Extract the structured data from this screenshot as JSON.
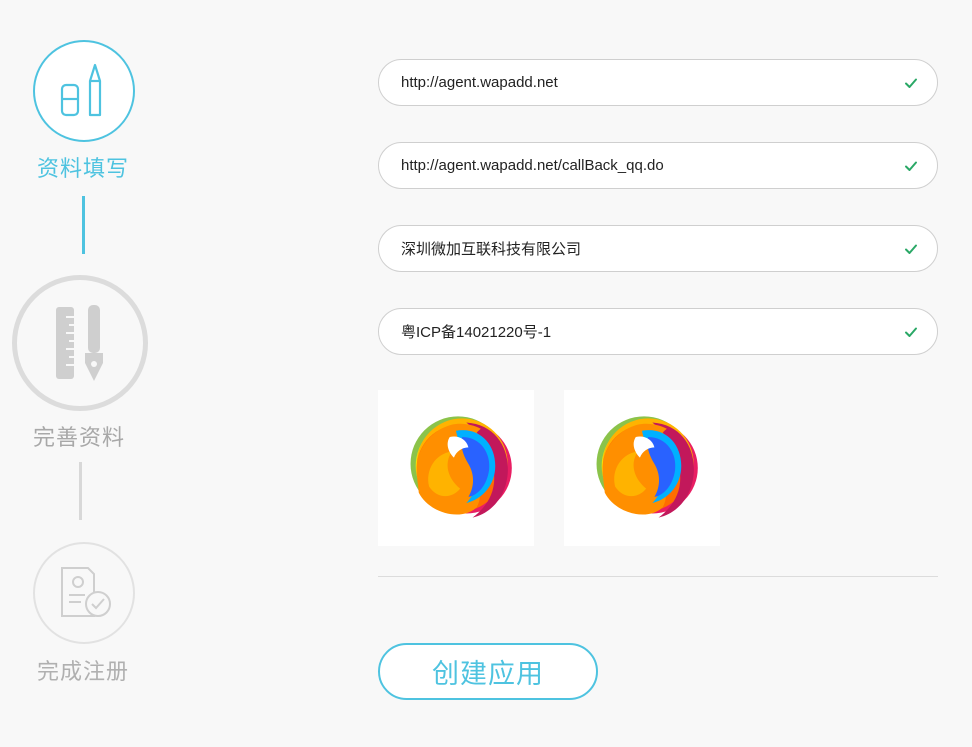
{
  "steps": [
    {
      "label": "资料填写",
      "state": "active",
      "icon": "pencil-eraser-icon"
    },
    {
      "label": "完善资料",
      "state": "pending",
      "icon": "ruler-pen-icon"
    },
    {
      "label": "完成注册",
      "state": "pending",
      "icon": "document-check-icon"
    }
  ],
  "form": {
    "site_url": "http://agent.wapadd.net",
    "callback_url": "http://agent.wapadd.net/callBack_qq.do",
    "company": "深圳微加互联科技有限公司",
    "icp": "粤ICP备14021220号-1"
  },
  "logos": [
    {
      "icon": "app-logo-large"
    },
    {
      "icon": "app-logo-small"
    }
  ],
  "create_button_label": "创建应用",
  "colors": {
    "accent": "#4ec3e0",
    "valid_check": "#2aa866",
    "inactive": "#dcdcdc",
    "background": "#f8f8f8"
  }
}
